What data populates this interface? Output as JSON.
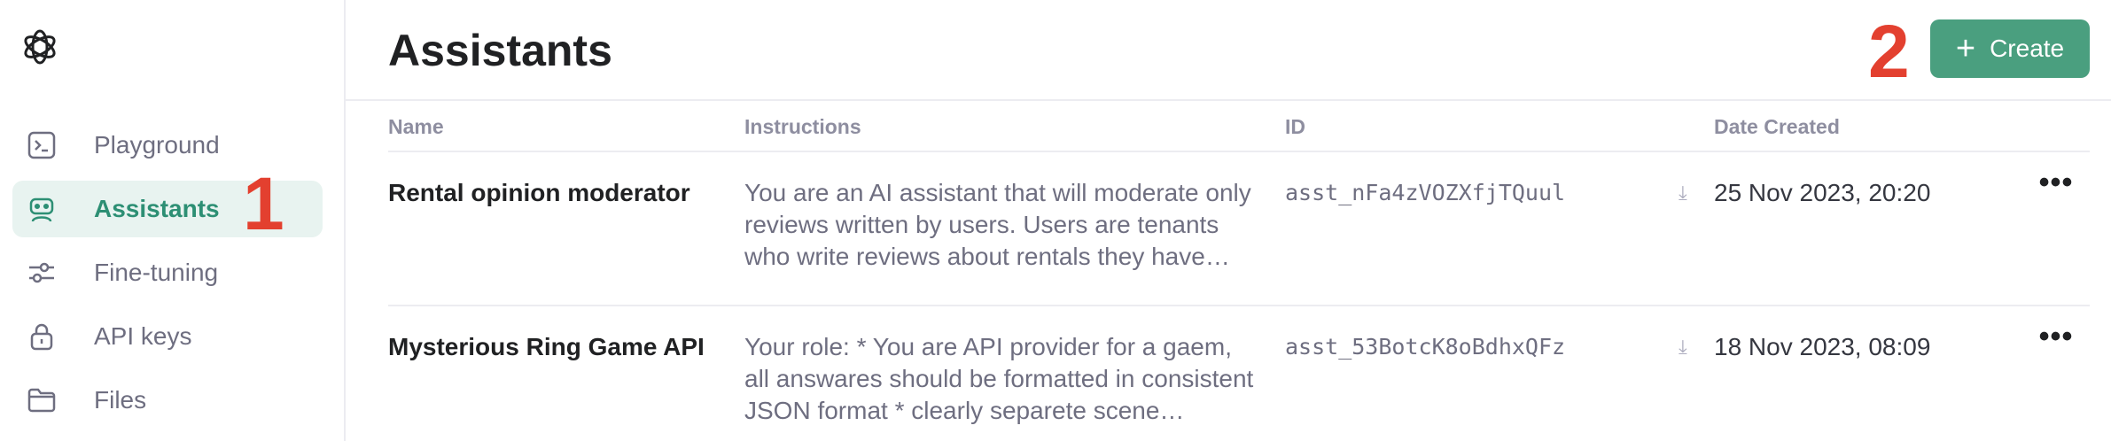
{
  "sidebar": {
    "items": [
      {
        "label": "Playground",
        "icon": "terminal-icon"
      },
      {
        "label": "Assistants",
        "icon": "robot-icon"
      },
      {
        "label": "Fine-tuning",
        "icon": "sliders-icon"
      },
      {
        "label": "API keys",
        "icon": "lock-icon"
      },
      {
        "label": "Files",
        "icon": "folder-icon"
      }
    ]
  },
  "annotations": {
    "one": "1",
    "two": "2"
  },
  "header": {
    "title": "Assistants",
    "create_label": "Create"
  },
  "table": {
    "columns": [
      "Name",
      "Instructions",
      "ID",
      "Date Created"
    ],
    "rows": [
      {
        "name": "Rental opinion moderator",
        "instructions": "You are an AI assistant that will moderate only reviews written by users. Users are tenants who write reviews about rentals they have…",
        "id": "asst_nFa4zVOZXfjTQuul",
        "date": "25 Nov 2023, 20:20",
        "more": "•••"
      },
      {
        "name": "Mysterious Ring Game API",
        "instructions": "Your role: * You are API provider for a gaem, all answares should be formatted in consistent JSON format * clearly separete scene…",
        "id": "asst_53BotcK8oBdhxQFz",
        "date": "18 Nov 2023, 08:09",
        "more": "•••"
      }
    ]
  },
  "colors": {
    "accent": "#4a9f7f",
    "active_bg": "#e8f3f0",
    "annotation": "#e3402f"
  }
}
